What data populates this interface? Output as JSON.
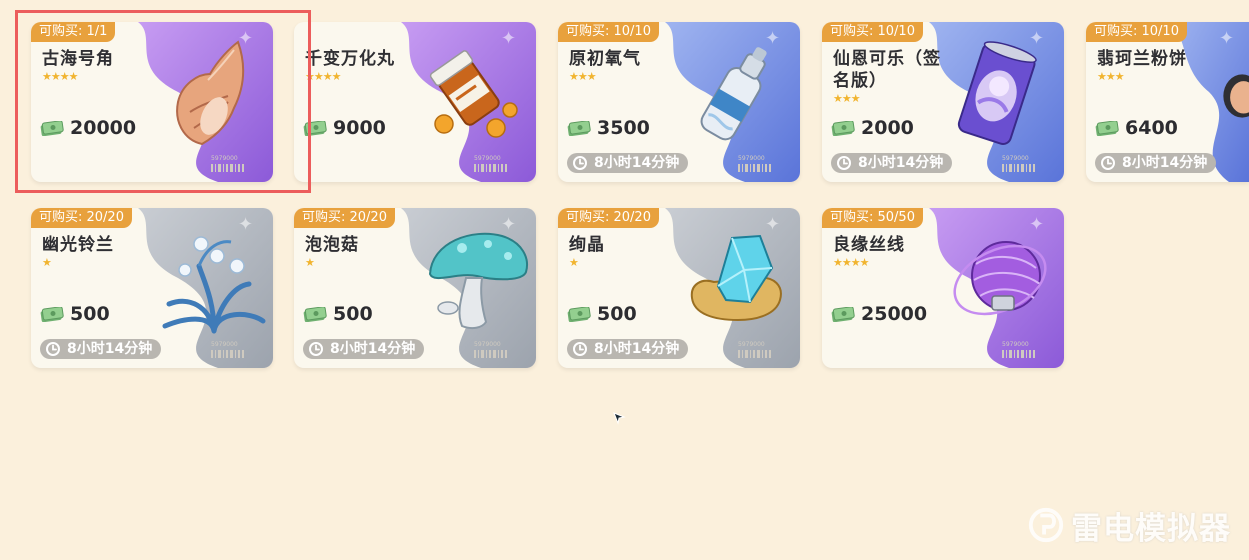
{
  "colors": {
    "page_bg": "#fbf0dc",
    "tag_bg": "#e8a13d",
    "star": "#f1b42f",
    "timer_bg": "#b9b6b0",
    "highlight": "#ec5d5c"
  },
  "shop": {
    "items": [
      {
        "limit": "可购买: 1/1",
        "name": "古海号角",
        "stars": "★★★★",
        "rarity": 4,
        "price": "20000",
        "timer": "",
        "bg": "purple",
        "icon": "conch-shell-icon"
      },
      {
        "limit": "",
        "name": "千变万化丸",
        "stars": "★★★★",
        "rarity": 4,
        "price": "9000",
        "timer": "",
        "bg": "purple",
        "icon": "pill-bottle-icon"
      },
      {
        "limit": "可购买: 10/10",
        "name": "原初氧气",
        "stars": "★★★",
        "rarity": 3,
        "price": "3500",
        "timer": "8小时14分钟",
        "bg": "blue",
        "icon": "oxygen-bottle-icon"
      },
      {
        "limit": "可购买: 10/10",
        "name": "仙恩可乐（签名版）",
        "name_line1": "仙恩可乐（签",
        "name_line2": "名版）",
        "stars": "★★★",
        "rarity": 3,
        "price": "2000",
        "timer": "8小时14分钟",
        "bg": "blue",
        "icon": "soda-can-icon"
      },
      {
        "limit": "可购买: 10/10",
        "name": "翡珂兰粉饼",
        "stars": "★★★",
        "rarity": 3,
        "price": "6400",
        "timer": "8小时14分钟",
        "bg": "blue",
        "icon": "compact-powder-icon"
      },
      {
        "limit": "可购买: 20/20",
        "name": "幽光铃兰",
        "stars": "★",
        "rarity": 1,
        "price": "500",
        "timer": "8小时14分钟",
        "bg": "gray",
        "icon": "lily-of-valley-icon"
      },
      {
        "limit": "可购买: 20/20",
        "name": "泡泡菇",
        "stars": "★",
        "rarity": 1,
        "price": "500",
        "timer": "8小时14分钟",
        "bg": "gray",
        "icon": "mushroom-icon"
      },
      {
        "limit": "可购买: 20/20",
        "name": "绚晶",
        "stars": "★",
        "rarity": 1,
        "price": "500",
        "timer": "8小时14分钟",
        "bg": "gray",
        "icon": "crystal-icon"
      },
      {
        "limit": "可购买: 50/50",
        "name": "良缘丝线",
        "stars": "★★★★",
        "rarity": 4,
        "price": "25000",
        "timer": "",
        "bg": "purple",
        "icon": "yarn-ball-icon"
      }
    ]
  },
  "watermark": {
    "text": "雷电模拟器"
  }
}
